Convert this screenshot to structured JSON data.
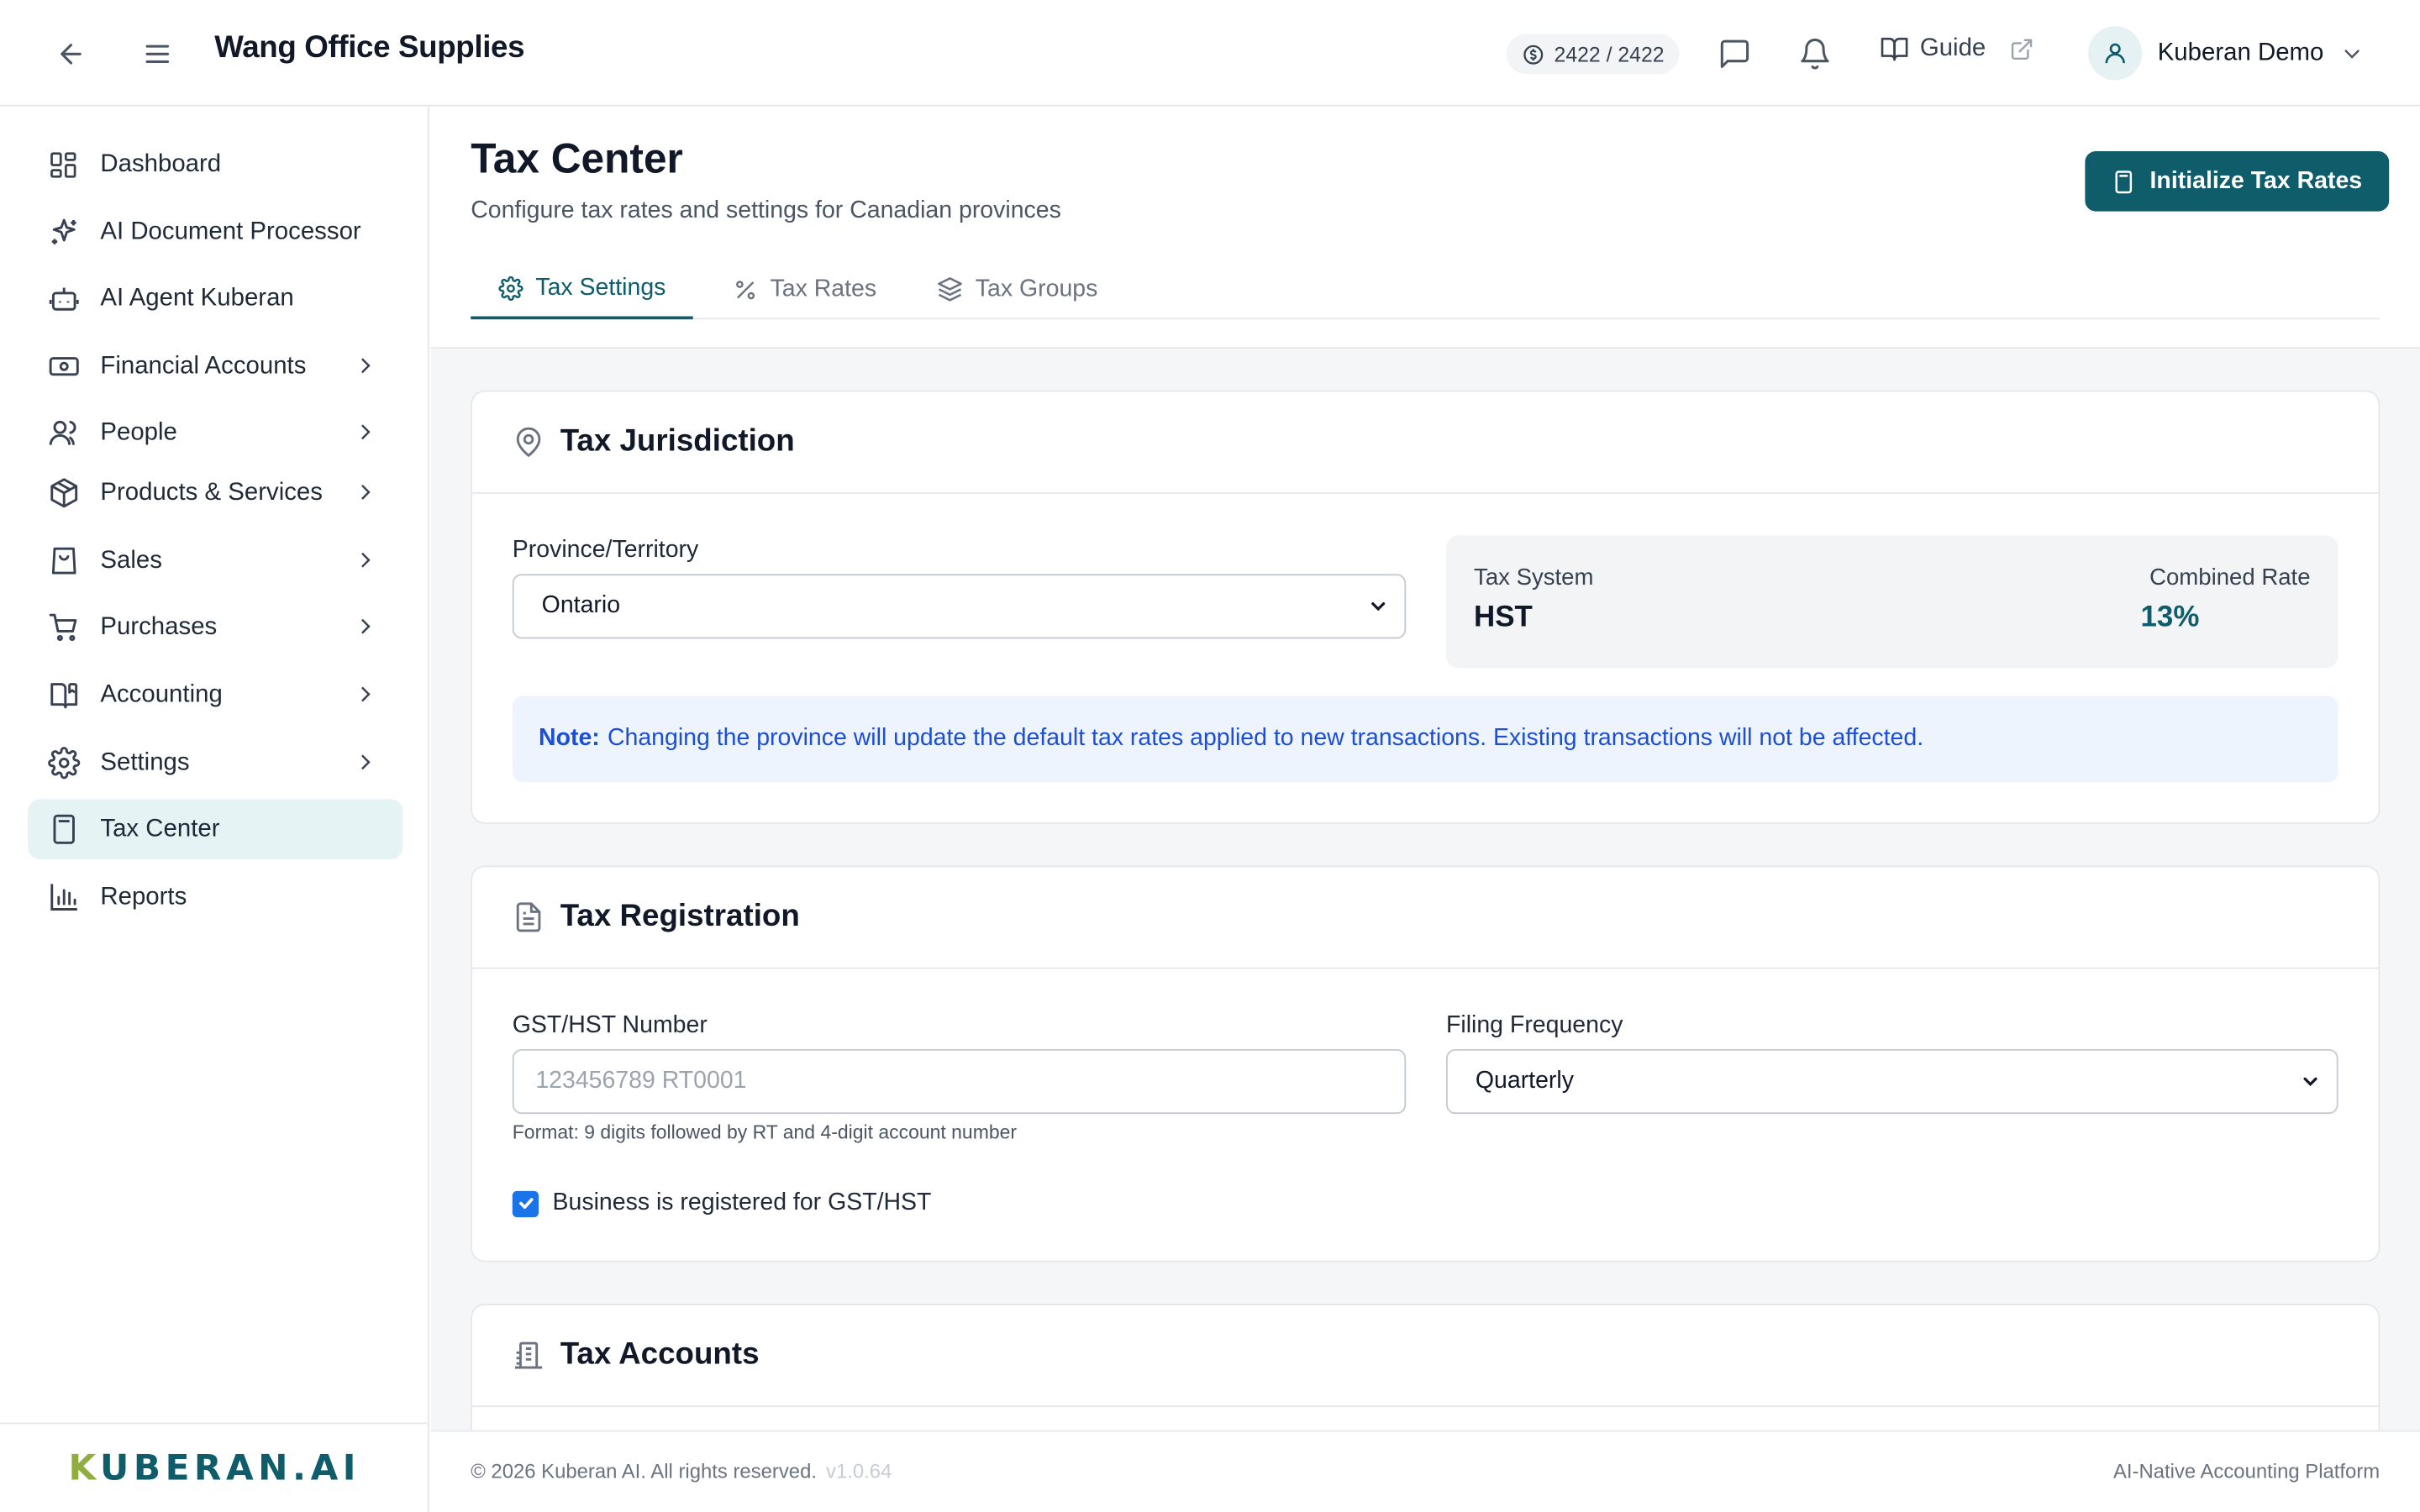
{
  "header": {
    "app_title": "Wang Office Supplies",
    "credits": "2422 / 2422",
    "guide_label": "Guide",
    "user_name": "Kuberan Demo"
  },
  "sidebar": {
    "items": [
      {
        "label": "Dashboard",
        "icon": "dashboard-icon"
      },
      {
        "label": "AI Document Processor",
        "icon": "sparkles-icon"
      },
      {
        "label": "AI Agent Kuberan",
        "icon": "bot-icon"
      },
      {
        "label": "Financial Accounts",
        "icon": "banknote-icon"
      },
      {
        "label": "People",
        "icon": "users-icon"
      },
      {
        "label": "Products & Services",
        "icon": "package-icon"
      },
      {
        "label": "Sales",
        "icon": "shopping-bag-icon"
      },
      {
        "label": "Purchases",
        "icon": "cart-icon"
      },
      {
        "label": "Accounting",
        "icon": "book-icon"
      },
      {
        "label": "Settings",
        "icon": "gear-icon"
      },
      {
        "label": "Tax Center",
        "icon": "calculator-icon"
      },
      {
        "label": "Reports",
        "icon": "bar-chart-icon"
      }
    ],
    "logo_k": "K",
    "logo_rest": "UBERAN.AI"
  },
  "page": {
    "title": "Tax Center",
    "subtitle": "Configure tax rates and settings for Canadian provinces",
    "init_button": "Initialize Tax Rates",
    "tabs": [
      {
        "label": "Tax Settings"
      },
      {
        "label": "Tax Rates"
      },
      {
        "label": "Tax Groups"
      }
    ]
  },
  "jurisdiction": {
    "title": "Tax Jurisdiction",
    "province_label": "Province/Territory",
    "province_value": "Ontario",
    "tax_system_label": "Tax System",
    "tax_system_value": "HST",
    "combined_rate_label": "Combined Rate",
    "combined_rate_value": "13%",
    "note_bold": "Note:",
    "note_text": "Changing the province will update the default tax rates applied to new transactions. Existing transactions will not be affected."
  },
  "registration": {
    "title": "Tax Registration",
    "gst_label": "GST/HST Number",
    "gst_placeholder": "123456789 RT0001",
    "gst_hint": "Format: 9 digits followed by RT and 4-digit account number",
    "filing_label": "Filing Frequency",
    "filing_value": "Quarterly",
    "registered_label": "Business is registered for GST/HST",
    "registered_checked": true
  },
  "accounts": {
    "title": "Tax Accounts"
  },
  "footer": {
    "copyright": "© 2026 Kuberan AI. All rights reserved.",
    "version": "v1.0.64",
    "tagline": "AI-Native Accounting Platform"
  },
  "colors": {
    "brand": "#0f5c6b",
    "accent_green": "#8fae3d",
    "note_blue": "#1d4ed8",
    "checkbox": "#1a73e8"
  }
}
